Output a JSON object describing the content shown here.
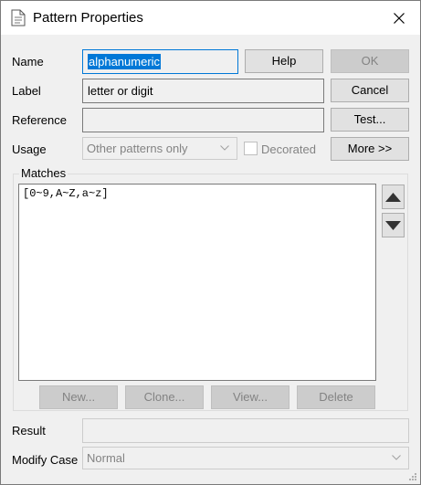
{
  "window": {
    "title": "Pattern Properties"
  },
  "labels": {
    "name": "Name",
    "label": "Label",
    "reference": "Reference",
    "usage": "Usage",
    "matches": "Matches",
    "result": "Result",
    "modify_case": "Modify Case"
  },
  "fields": {
    "name_value": "alphanumeric",
    "label_value": "letter or digit",
    "reference_value": "",
    "result_value": ""
  },
  "usage": {
    "selected": "Other patterns only"
  },
  "decorated": {
    "label": "Decorated",
    "checked": false
  },
  "modify_case": {
    "selected": "Normal"
  },
  "matches": {
    "text": "[0~9,A~Z,a~z]"
  },
  "buttons": {
    "help": "Help",
    "ok": "OK",
    "cancel": "Cancel",
    "test": "Test...",
    "more": "More >>",
    "new": "New...",
    "clone": "Clone...",
    "view": "View...",
    "delete": "Delete"
  }
}
